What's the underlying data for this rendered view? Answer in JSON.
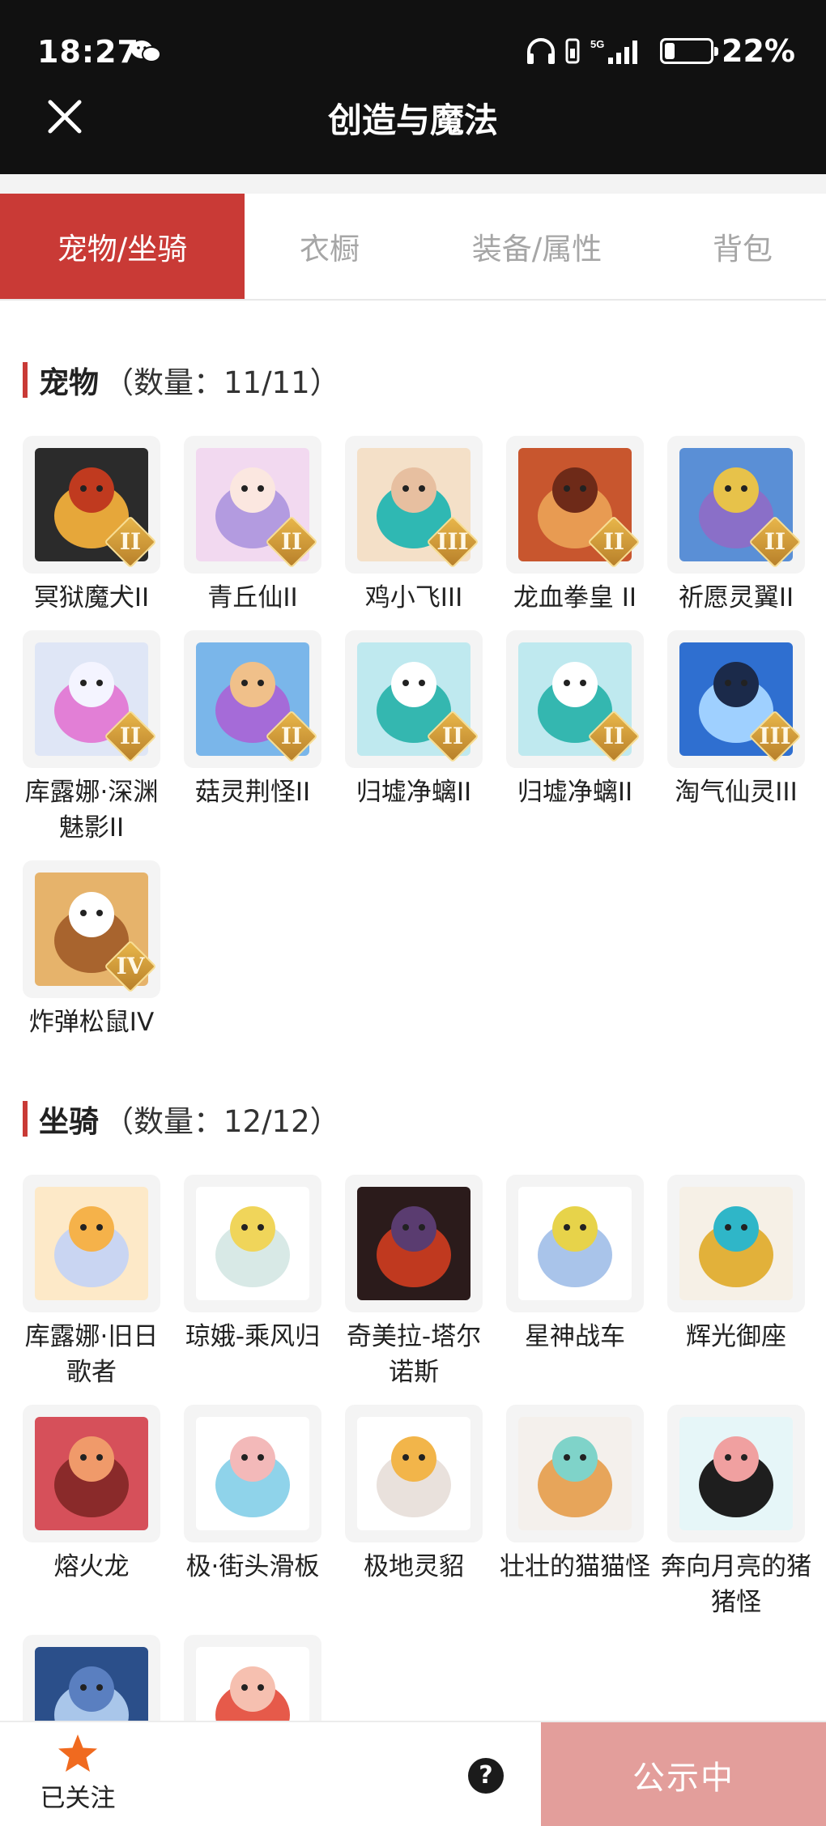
{
  "status_bar": {
    "time": "18:27",
    "battery": "22%",
    "battery_level": 0.22,
    "network": "5G"
  },
  "header": {
    "title": "创造与魔法"
  },
  "tabs": [
    {
      "label": "宠物/坐骑",
      "active": true
    },
    {
      "label": "衣橱",
      "active": false
    },
    {
      "label": "装备/属性",
      "active": false
    },
    {
      "label": "背包",
      "active": false
    }
  ],
  "pets": {
    "title": "宠物",
    "count": "（数量：11/11）",
    "items": [
      {
        "name": "冥狱魔犬II",
        "badge": "II"
      },
      {
        "name": "青丘仙II",
        "badge": "II"
      },
      {
        "name": "鸡小飞III",
        "badge": "III"
      },
      {
        "name": "龙血拳皇 II",
        "badge": "II"
      },
      {
        "name": "祈愿灵翼II",
        "badge": "II"
      },
      {
        "name": "库露娜·深渊魅影II",
        "badge": "II"
      },
      {
        "name": "菇灵荆怪II",
        "badge": "II"
      },
      {
        "name": "归墟净螭II",
        "badge": "II"
      },
      {
        "name": "归墟净螭II",
        "badge": "II"
      },
      {
        "name": "淘气仙灵III",
        "badge": "III"
      },
      {
        "name": "炸弹松鼠IV",
        "badge": "IV"
      }
    ]
  },
  "mounts": {
    "title": "坐骑",
    "count": "（数量：12/12）",
    "items": [
      {
        "name": "库露娜·旧日歌者"
      },
      {
        "name": "琼娥-乘风归"
      },
      {
        "name": "奇美拉-塔尔诺斯"
      },
      {
        "name": "星神战车"
      },
      {
        "name": "辉光御座"
      },
      {
        "name": "熔火龙"
      },
      {
        "name": "极·街头滑板"
      },
      {
        "name": "极地灵貂"
      },
      {
        "name": "壮壮的猫猫怪"
      },
      {
        "name": "奔向月亮的猪猪怪"
      },
      {
        "name": ""
      },
      {
        "name": ""
      }
    ]
  },
  "bottom_bar": {
    "follow_label": "已关注",
    "help_label": "?",
    "publish_label": "公示中"
  },
  "colors": {
    "accent": "#c93a36",
    "publish_button": "#e39e9b",
    "header_bg": "#111111",
    "star": "#f06a1f"
  }
}
